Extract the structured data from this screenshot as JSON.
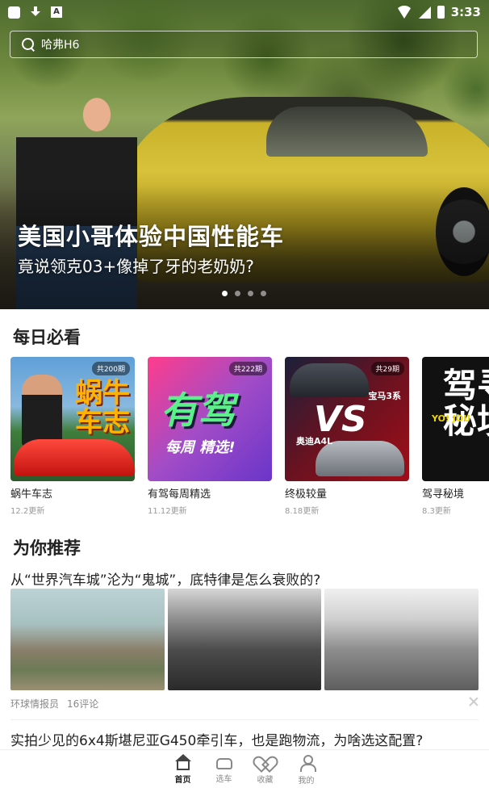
{
  "status_bar": {
    "time": "3:33",
    "icons": [
      "app-square-icon",
      "download-icon",
      "a-badge-icon",
      "wifi-icon",
      "signal-icon",
      "battery-icon"
    ]
  },
  "search": {
    "placeholder": "哈弗H6"
  },
  "hero": {
    "title": "美国小哥体验中国性能车",
    "subtitle": "竟说领克03+像掉了牙的老奶奶?",
    "page_indicator": {
      "count": 4,
      "active": 1
    }
  },
  "daily": {
    "title": "每日必看",
    "cards": [
      {
        "name": "蜗牛车志",
        "date": "12.2更新",
        "badge": "共200期",
        "cover_text": "蜗牛\n车志"
      },
      {
        "name": "有驾每周精选",
        "date": "11.12更新",
        "badge": "共222期",
        "cover_text_big": "有驾",
        "cover_text_small": "每周 精选!"
      },
      {
        "name": "终极较量",
        "date": "8.18更新",
        "badge": "共29期",
        "cover_vs": "VS",
        "cover_label_a": "宝马3系",
        "cover_label_b": "奥迪A4L"
      },
      {
        "name": "驾寻秘境",
        "date": "8.3更新",
        "badge": "",
        "cover_text": "驾寻\n秘境",
        "cover_tag": "YO! JOU"
      }
    ]
  },
  "recommend": {
    "title": "为你推荐",
    "articles": [
      {
        "title": "从“世界汽车城”沦为“鬼城”，底特律是怎么衰败的?",
        "source": "环球情报员",
        "comments": "16评论"
      },
      {
        "title": "实拍少见的6x4斯堪尼亚G450牵引车，也是跑物流，为啥选这配置?"
      }
    ]
  },
  "bottom_nav": {
    "items": [
      {
        "label": "首页",
        "icon": "home-icon",
        "active": true
      },
      {
        "label": "选车",
        "icon": "car-icon",
        "active": false
      },
      {
        "label": "收藏",
        "icon": "heart-icon",
        "active": false
      },
      {
        "label": "我的",
        "icon": "person-icon",
        "active": false
      }
    ]
  },
  "colors": {
    "primary_text": "#222222",
    "secondary_text": "#888888",
    "divider": "#eeeeee"
  }
}
